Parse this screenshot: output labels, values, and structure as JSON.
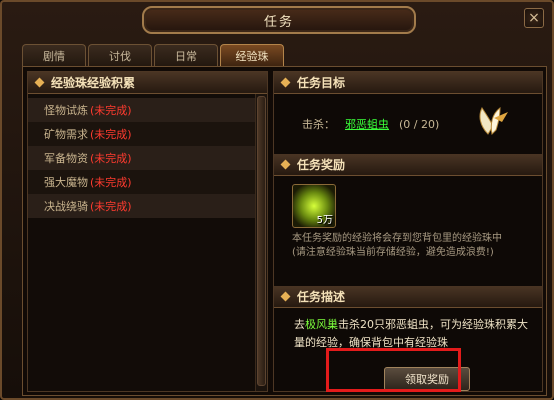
{
  "window": {
    "title": "任务",
    "close_label": "×"
  },
  "tabs": [
    "剧情",
    "讨伐",
    "日常",
    "经验珠"
  ],
  "left_panel": {
    "header": "经验珠经验积累",
    "quests": [
      {
        "name": "怪物试炼",
        "status": "(未完成)"
      },
      {
        "name": "矿物需求",
        "status": "(未完成)"
      },
      {
        "name": "军备物资",
        "status": "(未完成)"
      },
      {
        "name": "强大魔物",
        "status": "(未完成)"
      },
      {
        "name": "决战绕骑",
        "status": "(未完成)"
      }
    ]
  },
  "right_panel": {
    "target_header": "任务目标",
    "target_kill_label": "击杀：",
    "target_monster": "邪恶蛆虫",
    "target_progress": "(0 / 20)",
    "reward_header": "任务奖励",
    "reward_amount": "5万",
    "reward_desc_line1": "本任务奖励的经验将会存到您背包里的经验珠中",
    "reward_desc_line2": "(请注意经验珠当前存储经验，避免造成浪费!)",
    "desc_header": "任务描述",
    "desc_prefix": "去",
    "desc_place": "极风巢",
    "desc_rest": "击杀20只邪恶蛆虫，可为经验珠积累大量的经验，确保背包中有经验珠",
    "claim_button": "领取奖励"
  },
  "colors": {
    "accent_gold": "#e7b155",
    "incomplete_red": "#ff3b2f",
    "link_green": "#3aff3a",
    "highlight_box": "#e31b1b"
  },
  "icons": {
    "close": "close-icon",
    "wings": "wings-icon",
    "reward": "exp-orb-icon"
  }
}
